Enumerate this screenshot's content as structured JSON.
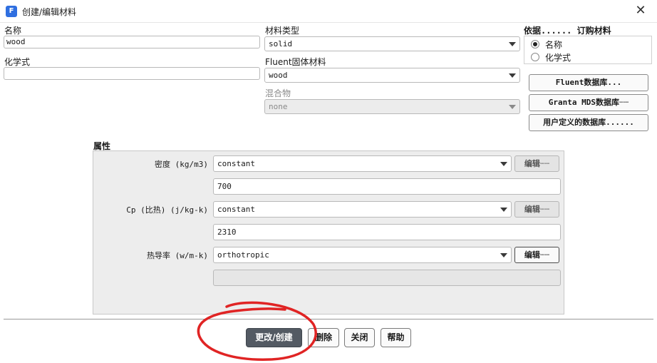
{
  "window": {
    "app_icon": "F",
    "title": "创建/编辑材料",
    "close_glyph": "✕"
  },
  "form": {
    "name_label": "名称",
    "name_value": "wood",
    "formula_label": "化学式",
    "formula_value": "",
    "material_type_label": "材料类型",
    "material_type_value": "solid",
    "fluent_solid_label": "Fluent固体材料",
    "fluent_solid_value": "wood",
    "mixture_label": "混合物",
    "mixture_value": "none"
  },
  "order_by": {
    "title": "依据...... 订购材料",
    "options": [
      {
        "label": "名称",
        "selected": true
      },
      {
        "label": "化学式",
        "selected": false
      }
    ]
  },
  "databases": {
    "fluent": "Fluent数据库...",
    "granta": "Granta MDS数据库┄┄",
    "user_defined": "用户定义的数据库......"
  },
  "properties": {
    "title": "属性",
    "rows": [
      {
        "label": "密度 (kg/m3)",
        "method": "constant",
        "edit": "编辑┄┄",
        "value": "700"
      },
      {
        "label": "Cp (比热) (j/kg-k)",
        "method": "constant",
        "edit": "编辑┄┄",
        "value": "2310"
      },
      {
        "label": "热导率 (w/m-k)",
        "method": "orthotropic",
        "edit": "编辑┄┄",
        "value": ""
      }
    ]
  },
  "footer": {
    "change_create": "更改/创建",
    "delete": "删除",
    "close": "关闭",
    "help": "帮助"
  },
  "icons": {
    "caret": "chevron-down-icon",
    "close": "close-icon"
  },
  "colors": {
    "app_icon": "#2f6fe0",
    "primary_button": "#535a63",
    "annotation": "#e02424"
  }
}
